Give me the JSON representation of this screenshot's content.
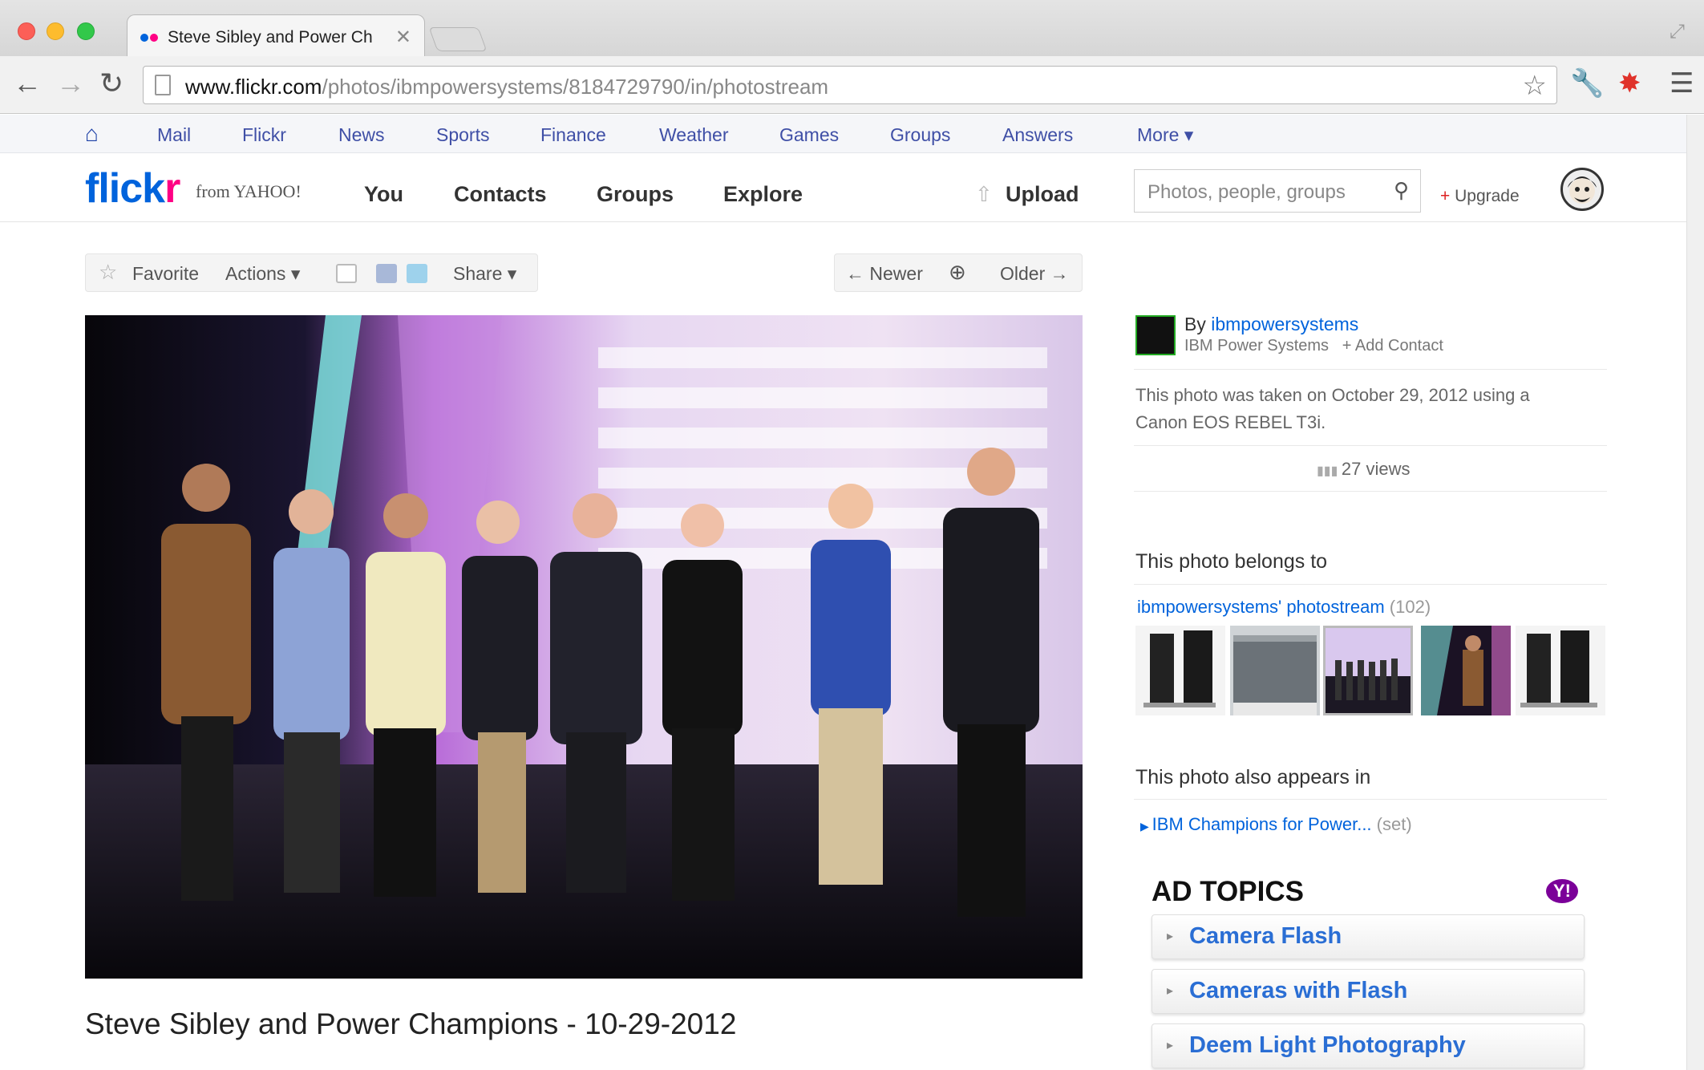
{
  "browser": {
    "tab_title": "Steve Sibley and Power Ch",
    "url_host": "www.flickr.com",
    "url_path": "/photos/ibmpowersystems/8184729790/in/photostream"
  },
  "yahoo_bar": {
    "items": [
      "Mail",
      "Flickr",
      "News",
      "Sports",
      "Finance",
      "Weather",
      "Games",
      "Groups",
      "Answers",
      "More ▾"
    ]
  },
  "flickr_header": {
    "logo_flick": "flick",
    "logo_r": "r",
    "from_yahoo": "from YAHOO!",
    "nav": [
      "You",
      "Contacts",
      "Groups",
      "Explore"
    ],
    "upload": "Upload",
    "search_placeholder": "Photos, people, groups",
    "upgrade": "Upgrade"
  },
  "action_bar": {
    "favorite": "Favorite",
    "actions": "Actions ▾",
    "share": "Share ▾",
    "newer": "← Newer",
    "older": "Older →"
  },
  "photo": {
    "title": "Steve Sibley and Power Champions - 10-29-2012"
  },
  "sidebar": {
    "by_prefix": "By ",
    "owner": "ibmpowersystems",
    "owner_name": "IBM Power Systems",
    "add_contact": "+ Add Contact",
    "taken": "This photo was taken on October 29, 2012 using a Canon EOS REBEL T3i.",
    "views": "27 views",
    "belongs_heading": "This photo belongs to",
    "stream_label": "ibmpowersystems' photostream",
    "stream_count": "(102)",
    "appears_heading": "This photo also appears in",
    "set_label": "IBM Champions for Power...",
    "set_tag": "(set)"
  },
  "ads": {
    "heading": "AD TOPICS",
    "items": [
      "Camera Flash",
      "Cameras with Flash",
      "Deem Light Photography"
    ]
  },
  "colors": {
    "flickr_blue": "#0063dc",
    "flickr_pink": "#ff0084",
    "yahoo_purple": "#7b0099",
    "link_blue": "#0063dc"
  }
}
